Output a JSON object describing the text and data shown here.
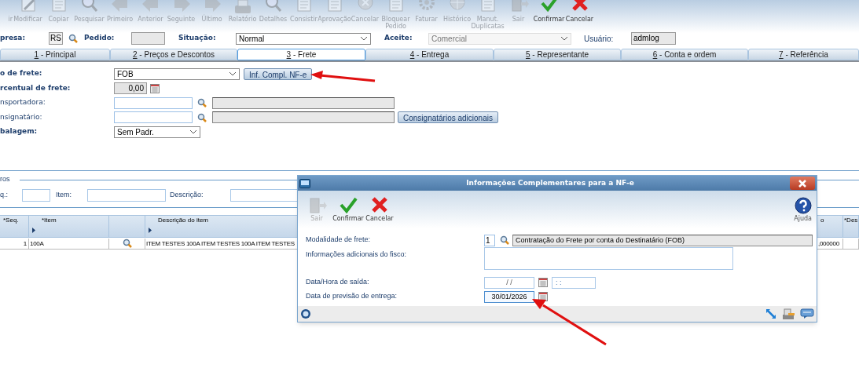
{
  "toolbar": [
    {
      "label": "ir",
      "disabled": true
    },
    {
      "label": "Modificar",
      "disabled": true
    },
    {
      "label": "Copiar",
      "disabled": true
    },
    {
      "label": "Pesquisar",
      "disabled": true
    },
    {
      "label": "Primeiro",
      "disabled": true
    },
    {
      "label": "Anterior",
      "disabled": true
    },
    {
      "label": "Seguinte",
      "disabled": true
    },
    {
      "label": "Último",
      "disabled": true
    },
    {
      "label": "Relatório",
      "disabled": true
    },
    {
      "label": "Detalhes",
      "disabled": true
    },
    {
      "label": "Consistir",
      "disabled": true
    },
    {
      "label": "Aprovação",
      "disabled": true
    },
    {
      "label": "Cancelar",
      "disabled": true
    },
    {
      "label": "Bloquear Pedido",
      "disabled": true
    },
    {
      "label": "Faturar",
      "disabled": true
    },
    {
      "label": "Histórico",
      "disabled": true
    },
    {
      "label": "Manut. Duplicatas",
      "disabled": true
    },
    {
      "label": "Sair",
      "disabled": true
    },
    {
      "label": "Confirmar",
      "disabled": false
    },
    {
      "label": "Cancelar",
      "disabled": false
    }
  ],
  "header": {
    "company": {
      "label": "presa:",
      "value": "RS"
    },
    "order": {
      "label": "Pedido:"
    },
    "status": {
      "label": "Situação:",
      "value": "Normal"
    },
    "acceptance": {
      "label": "Aceite:",
      "value": "Comercial",
      "disabled": true
    },
    "user": {
      "label": "Usuário:",
      "value": "admlog"
    }
  },
  "tabs": [
    {
      "label": "1 - Principal",
      "selected": false
    },
    {
      "label": "2 - Preços e Descontos",
      "selected": false
    },
    {
      "label": "3 - Frete",
      "selected": true
    },
    {
      "label": "4 - Entrega",
      "selected": false
    },
    {
      "label": "5 - Representante",
      "selected": false
    },
    {
      "label": "6 - Conta e ordem",
      "selected": false
    },
    {
      "label": "7 - Referência",
      "selected": false
    }
  ],
  "freight_form": [
    {
      "kind": "select",
      "label": "o de frete:",
      "bold": true,
      "value": "FOB",
      "button": "Inf. Compl. NF-e"
    },
    {
      "kind": "number",
      "label": "rcentual de frete:",
      "bold": true,
      "value": "0,00"
    },
    {
      "kind": "lookup",
      "label": "nsportadora:",
      "bold": false
    },
    {
      "kind": "lookup",
      "label": "nsignatário:",
      "bold": false,
      "button": "Consignatários adicionais"
    },
    {
      "kind": "select",
      "label": "balagem:",
      "bold": true,
      "value": "Sem Padr."
    }
  ],
  "filters": {
    "title": "ros",
    "fields": [
      {
        "label": "q.:"
      },
      {
        "label": "Item:"
      },
      {
        "label": "Descrição:"
      }
    ]
  },
  "table": {
    "columns": [
      {
        "kind": "text",
        "label": "*Seq.",
        "marker": false
      },
      {
        "kind": "text",
        "label": "*Item",
        "marker": true
      },
      {
        "kind": "lookup"
      },
      {
        "kind": "text",
        "label": "Descrição do item",
        "marker": true
      },
      {
        "kind": "text",
        "label": "o",
        "marker": false
      },
      {
        "kind": "text",
        "label": "*Des",
        "marker": false
      }
    ],
    "rows": [
      {
        "cells": [
          "1",
          "100A",
          null,
          "ITEM TESTES 100A ITEM TESTES 100A ITEM TESTES",
          ",000000",
          null
        ]
      }
    ]
  },
  "dialog": {
    "title": "Informações Complementares para a NF-e",
    "toolbar": [
      {
        "label": "Sair",
        "disabled": true
      },
      {
        "label": "Confirmar",
        "disabled": false
      },
      {
        "label": "Cancelar",
        "disabled": false
      }
    ],
    "help": "Ajuda",
    "fields": [
      {
        "kind": "lookup",
        "label": "Modalidade de frete:",
        "code": "1",
        "value": "Contratação do Frete por conta do Destinatário (FOB)"
      },
      {
        "kind": "textarea",
        "label": "Informações adicionais do fisco:"
      },
      {
        "kind": "datetime",
        "label": "Data/Hora de saída:",
        "date": "/ /",
        "time": ": :",
        "focused": false
      },
      {
        "kind": "date",
        "label": "Data de previsão de entrega:",
        "date": "30/01/2026",
        "focused": true
      }
    ]
  }
}
